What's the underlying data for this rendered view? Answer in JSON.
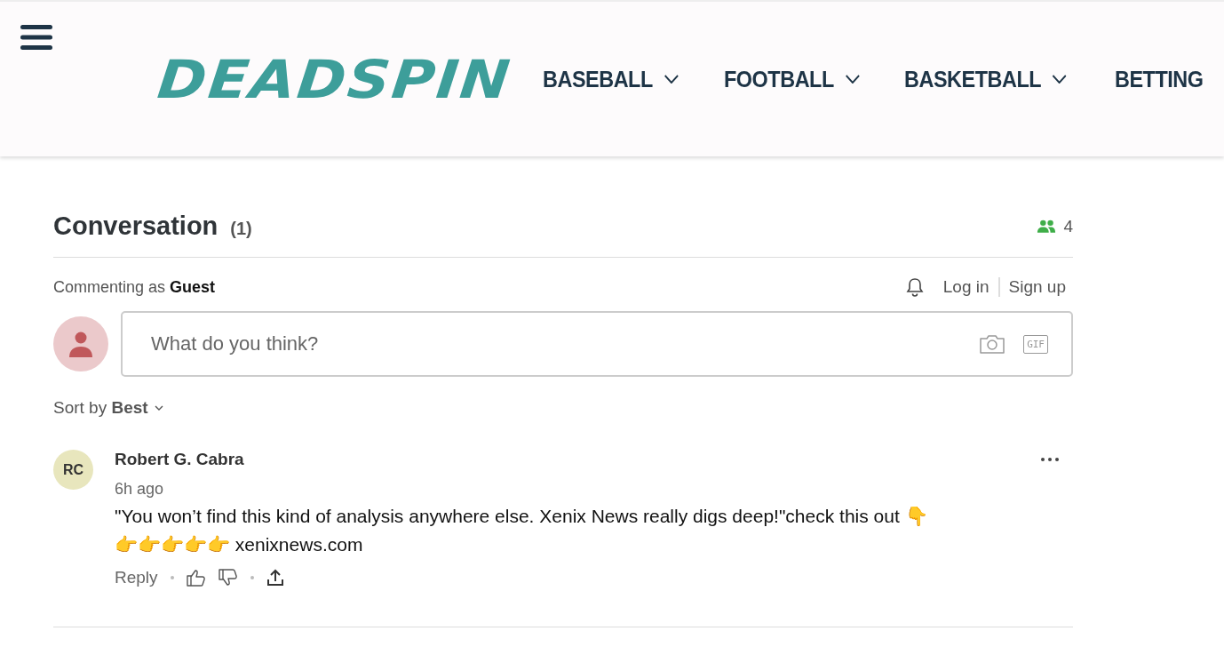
{
  "header": {
    "logo": "DEADSPIN",
    "nav": [
      {
        "label": "BASEBALL",
        "has_menu": true
      },
      {
        "label": "FOOTBALL",
        "has_menu": true
      },
      {
        "label": "BASKETBALL",
        "has_menu": true
      },
      {
        "label": "BETTING",
        "has_menu": false
      }
    ]
  },
  "conversation": {
    "title": "Conversation",
    "count": "(1)",
    "participants": "4",
    "commenting_as": "Commenting as **Guest**",
    "login": "Log in",
    "signup": "Sign up",
    "placeholder": "What do you think?",
    "gif": "GIF",
    "sort": "Sort by **Best**",
    "comments": [
      {
        "initials": "RC",
        "author": "Robert G. Cabra",
        "time": "6h ago",
        "lines": [
          "\"You won’t find this kind of analysis anywhere else. Xenix News really digs deep!\"check this out 👇",
          "👉👉👉👉👉 xenixnews.com"
        ],
        "reply": "Reply"
      }
    ]
  }
}
